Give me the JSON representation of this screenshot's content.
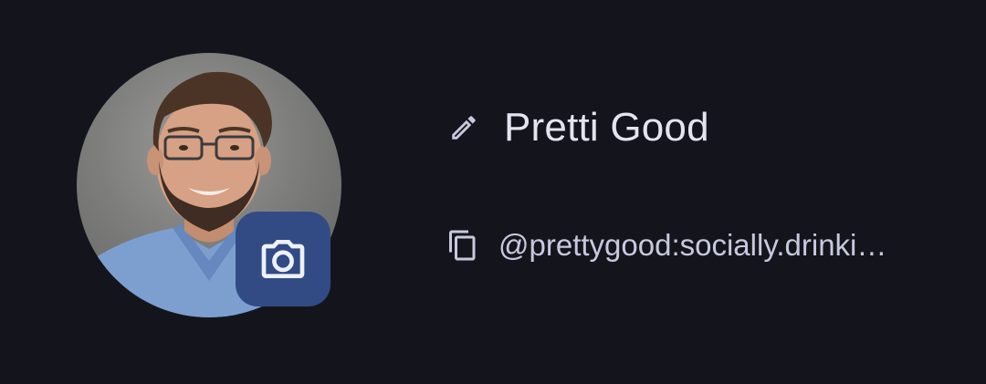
{
  "profile": {
    "display_name": "Pretti Good",
    "handle": "@prettygood:socially.drinki…"
  },
  "icons": {
    "edit": "pencil-icon",
    "copy": "copy-icon",
    "camera": "camera-icon"
  },
  "colors": {
    "background": "#14151c",
    "accent": "#324b84",
    "name_text": "#e4e4ee",
    "handle_text": "#c6c9de",
    "icon": "#c6c9de"
  }
}
